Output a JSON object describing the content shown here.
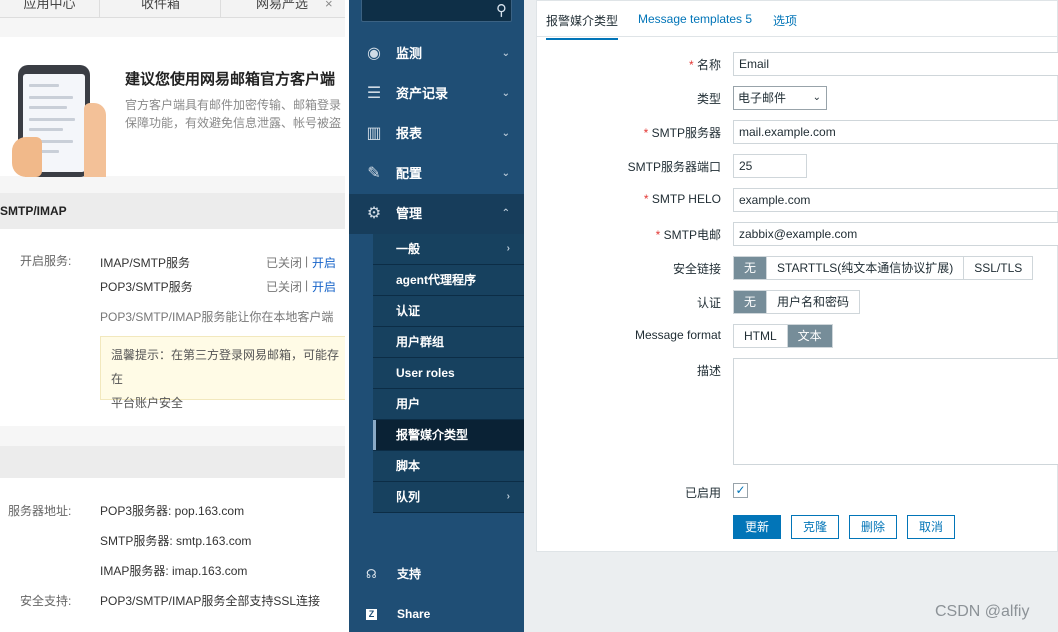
{
  "mail": {
    "tabs": [
      "应用中心",
      "收件箱",
      "网易严选"
    ],
    "tab_close": "×",
    "banner": {
      "title": "建议您使用网易邮箱官方客户端",
      "desc_line1": "官方客户端具有邮件加密传输、邮箱登录",
      "desc_line2": "保障功能，有效避免信息泄露、帐号被盗"
    },
    "section_title": "SMTP/IMAP",
    "service_label": "开启服务:",
    "services": [
      {
        "name": "IMAP/SMTP服务",
        "status": "已关闭",
        "sep": "|",
        "action": "开启"
      },
      {
        "name": "POP3/SMTP服务",
        "status": "已关闭",
        "sep": "|",
        "action": "开启"
      }
    ],
    "service_note": "POP3/SMTP/IMAP服务能让你在本地客户端",
    "tip_line1": "温馨提示：在第三方登录网易邮箱，可能存在",
    "tip_line2": "平台账户安全",
    "server_label": "服务器地址:",
    "servers": [
      "POP3服务器: pop.163.com",
      "SMTP服务器: smtp.163.com",
      "IMAP服务器: imap.163.com"
    ],
    "security_label": "安全支持:",
    "security_value": "POP3/SMTP/IMAP服务全部支持SSL连接"
  },
  "sidebar": {
    "search_icon": "🔍",
    "items": [
      {
        "label": "监测",
        "icon": "eye-icon",
        "glyph": "◉"
      },
      {
        "label": "资产记录",
        "icon": "list-icon",
        "glyph": "☰"
      },
      {
        "label": "报表",
        "icon": "bar-chart-icon",
        "glyph": "▥"
      },
      {
        "label": "配置",
        "icon": "wrench-icon",
        "glyph": "✎"
      },
      {
        "label": "管理",
        "icon": "gear-icon",
        "glyph": "⚙"
      }
    ],
    "chev_down": "⌄",
    "chev_up": "⌃",
    "chev_right": "›",
    "sub_items": [
      "一般",
      "agent代理程序",
      "认证",
      "用户群组",
      "User roles",
      "用户",
      "报警媒介类型",
      "脚本",
      "队列"
    ],
    "footer": [
      {
        "label": "支持",
        "icon": "headset-icon",
        "glyph": "☊"
      },
      {
        "label": "Share",
        "icon": "share-icon",
        "glyph": "Z"
      }
    ]
  },
  "form": {
    "tabs": {
      "active": "报警媒介类型",
      "templates": "Message templates",
      "templates_count": "5",
      "options": "选项"
    },
    "required_mark": "*",
    "name_label": "名称",
    "name_value": "Email",
    "type_label": "类型",
    "type_value": "电子邮件",
    "type_arrow": "⌄",
    "smtp_server_label": "SMTP服务器",
    "smtp_server_value": "mail.example.com",
    "smtp_port_label": "SMTP服务器端口",
    "smtp_port_value": "25",
    "smtp_helo_label": "SMTP HELO",
    "smtp_helo_value": "example.com",
    "smtp_email_label": "SMTP电邮",
    "smtp_email_value": "zabbix@example.com",
    "security_label": "安全链接",
    "security_options": [
      "无",
      "STARTTLS(纯文本通信协议扩展)",
      "SSL/TLS"
    ],
    "auth_label": "认证",
    "auth_options": [
      "无",
      "用户名和密码"
    ],
    "format_label": "Message format",
    "format_options": [
      "HTML",
      "文本"
    ],
    "desc_label": "描述",
    "enabled_label": "已启用",
    "enabled_mark": "✓",
    "buttons": {
      "update": "更新",
      "clone": "克隆",
      "delete": "删除",
      "cancel": "取消"
    }
  },
  "watermark": "CSDN @alfiy"
}
